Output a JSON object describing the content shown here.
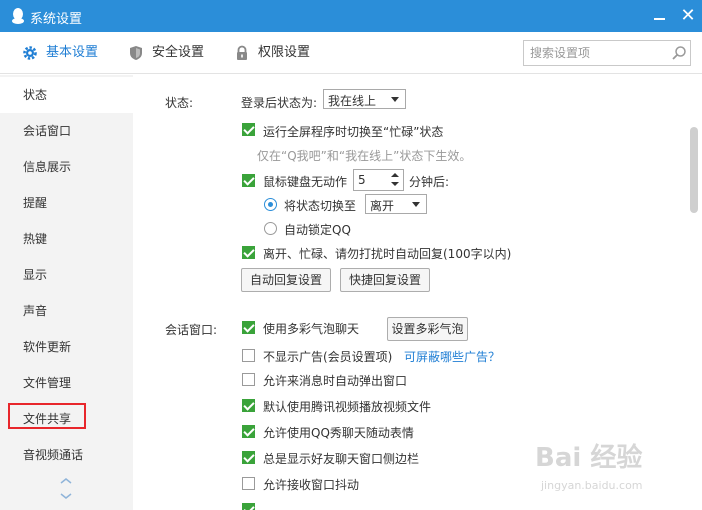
{
  "window": {
    "title": "系统设置",
    "close_glyph": "✕"
  },
  "tabs": [
    {
      "label": "基本设置",
      "icon": "gear-icon",
      "active": true
    },
    {
      "label": "安全设置",
      "icon": "shield-icon",
      "active": false
    },
    {
      "label": "权限设置",
      "icon": "lock-icon",
      "active": false
    }
  ],
  "search": {
    "placeholder": "搜索设置项",
    "icon": "search-icon"
  },
  "sidebar": {
    "items": [
      {
        "label": "状态",
        "active": true
      },
      {
        "label": "会话窗口"
      },
      {
        "label": "信息展示"
      },
      {
        "label": "提醒"
      },
      {
        "label": "热键"
      },
      {
        "label": "显示"
      },
      {
        "label": "声音"
      },
      {
        "label": "软件更新"
      },
      {
        "label": "文件管理"
      },
      {
        "label": "文件共享",
        "highlighted": true
      },
      {
        "label": "音视频通话"
      }
    ]
  },
  "status_section": {
    "label": "状态:",
    "login_status_label": "登录后状态为:",
    "login_status_value": "我在线上",
    "fullscreen_busy": {
      "label": "运行全屏程序时切换至“忙碌”状态",
      "checked": true
    },
    "fullscreen_note": "仅在“Q我吧”和“我在线上”状态下生效。",
    "idle": {
      "label": "鼠标键盘无动作",
      "checked": true,
      "minutes": "5",
      "unit": "分钟后:"
    },
    "switch_status": {
      "label": "将状态切换至",
      "value": "离开",
      "selected": true
    },
    "auto_lock": {
      "label": "自动锁定QQ",
      "selected": false
    },
    "auto_reply": {
      "label": "离开、忙碌、请勿打扰时自动回复(100字以内)",
      "checked": true
    },
    "auto_reply_button": "自动回复设置",
    "quick_reply_button": "快捷回复设置"
  },
  "session_section": {
    "label": "会话窗口:",
    "options": [
      {
        "label": "使用多彩气泡聊天",
        "checked": true
      },
      {
        "label": "不显示广告(会员设置项)",
        "checked": false
      },
      {
        "label": "允许来消息时自动弹出窗口",
        "checked": false
      },
      {
        "label": "默认使用腾讯视频播放视频文件",
        "checked": true
      },
      {
        "label": "允许使用QQ秀聊天随动表情",
        "checked": true
      },
      {
        "label": "总是显示好友聊天窗口侧边栏",
        "checked": true
      },
      {
        "label": "允许接收窗口抖动",
        "checked": false
      }
    ],
    "bubble_button": "设置多彩气泡",
    "ad_link": "可屏蔽哪些广告？"
  },
  "watermark": {
    "text": "Bai 经验",
    "url": "jingyan.baidu.com"
  },
  "colors": {
    "titlebar": "#2b8ed9",
    "accent": "#1f7ed4",
    "check": "#3aa33a",
    "highlight": "#e8262b"
  }
}
